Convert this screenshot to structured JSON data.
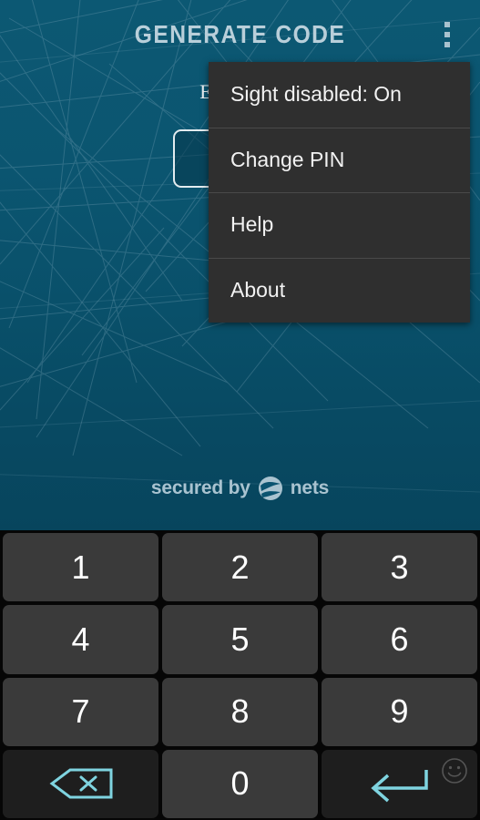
{
  "app": {
    "title": "GENERATE CODE",
    "overflow_icon": "more-vert-icon",
    "accent_color": "#7fd4e0",
    "background_color": "#0a5370",
    "key_color": "#3a3a3a"
  },
  "content": {
    "prompt": "Enter PIN",
    "pin_value": "",
    "pin_placeholder": ""
  },
  "brand": {
    "text_before": "secured by",
    "logo_icon": "nets-logo-icon",
    "text_after": "nets"
  },
  "menu": {
    "items": [
      {
        "label": "Sight disabled: On"
      },
      {
        "label": "Change PIN"
      },
      {
        "label": "Help"
      },
      {
        "label": "About"
      }
    ]
  },
  "keypad": {
    "keys": [
      {
        "label": "1",
        "name": "key-1",
        "type": "digit"
      },
      {
        "label": "2",
        "name": "key-2",
        "type": "digit"
      },
      {
        "label": "3",
        "name": "key-3",
        "type": "digit"
      },
      {
        "label": "4",
        "name": "key-4",
        "type": "digit"
      },
      {
        "label": "5",
        "name": "key-5",
        "type": "digit"
      },
      {
        "label": "6",
        "name": "key-6",
        "type": "digit"
      },
      {
        "label": "7",
        "name": "key-7",
        "type": "digit"
      },
      {
        "label": "8",
        "name": "key-8",
        "type": "digit"
      },
      {
        "label": "9",
        "name": "key-9",
        "type": "digit"
      },
      {
        "label": "",
        "name": "key-backspace",
        "type": "backspace"
      },
      {
        "label": "0",
        "name": "key-0",
        "type": "digit"
      },
      {
        "label": "",
        "name": "key-enter",
        "type": "enter"
      }
    ],
    "backspace_icon": "backspace-icon",
    "enter_icon": "enter-arrow-icon",
    "smiley_icon": "smiley-icon"
  }
}
